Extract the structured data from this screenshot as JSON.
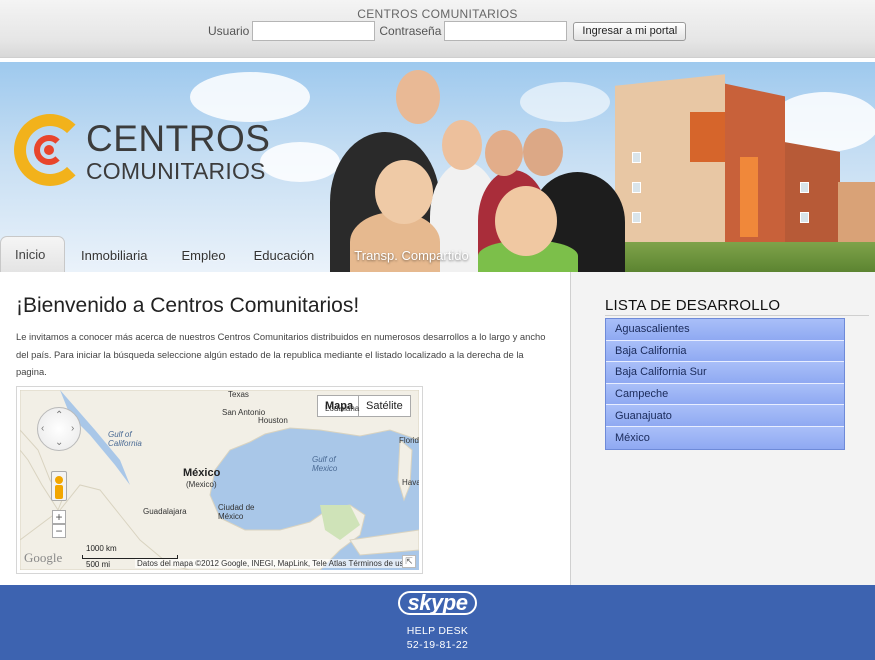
{
  "header": {
    "site_name": "CENTROS COMUNITARIOS",
    "username_label": "Usuario",
    "password_label": "Contraseña",
    "username_value": "",
    "password_value": "",
    "login_button": "Ingresar a mi portal"
  },
  "logo": {
    "line1": "CENTROS",
    "line2": "COMUNITARIOS",
    "ring_color": "#f2b21b",
    "center_color": "#e8452c"
  },
  "nav": {
    "tabs": [
      {
        "label": "Inicio",
        "active": true
      },
      {
        "label": "Inmobiliaria",
        "active": false
      },
      {
        "label": "Empleo",
        "active": false
      },
      {
        "label": "Educación",
        "active": false
      },
      {
        "label": "Transp. Compartido",
        "active": false
      }
    ]
  },
  "main": {
    "title": "¡Bienvenido a Centros Comunitarios!",
    "intro": "Le invitamos a conocer más acerca de nuestros Centros Comunitarios distribuidos en numerosos desarrollos a lo largo y ancho del país. Para iniciar la búsqueda seleccione algún estado de la republica mediante el listado localizado a la derecha de la pagina."
  },
  "map": {
    "type_buttons": {
      "map": "Mapa",
      "satellite": "Satélite"
    },
    "labels": {
      "texas": "Texas",
      "san_antonio": "San Antonio",
      "houston": "Houston",
      "louisiana": "Louisiana",
      "florida": "Florida",
      "gulf_california": "Gulf of California",
      "gulf_mexico": "Gulf of Mexico",
      "mexico": "México",
      "mexico_alt": "(Mexico)",
      "guadalajara": "Guadalajara",
      "ciudad_mexico": "Ciudad de México",
      "havana": "Havana"
    },
    "google": "Google",
    "scale_km": "1000 km",
    "scale_mi": "500 mi",
    "attribution": "Datos del mapa ©2012 Google, INEGI, MapLink, Tele Atlas",
    "terms": "Términos de uso"
  },
  "sidebar": {
    "title": "LISTA DE DESARROLLO",
    "states": [
      "Aguascalientes",
      "Baja California",
      "Baja California Sur",
      "Campeche",
      "Guanajuato",
      "México"
    ],
    "item_color": "#9db4f5"
  },
  "footer": {
    "skype": "skype",
    "help_desk": "HELP DESK",
    "phone": "52-19-81-22",
    "bg_color": "#3d63b0"
  }
}
